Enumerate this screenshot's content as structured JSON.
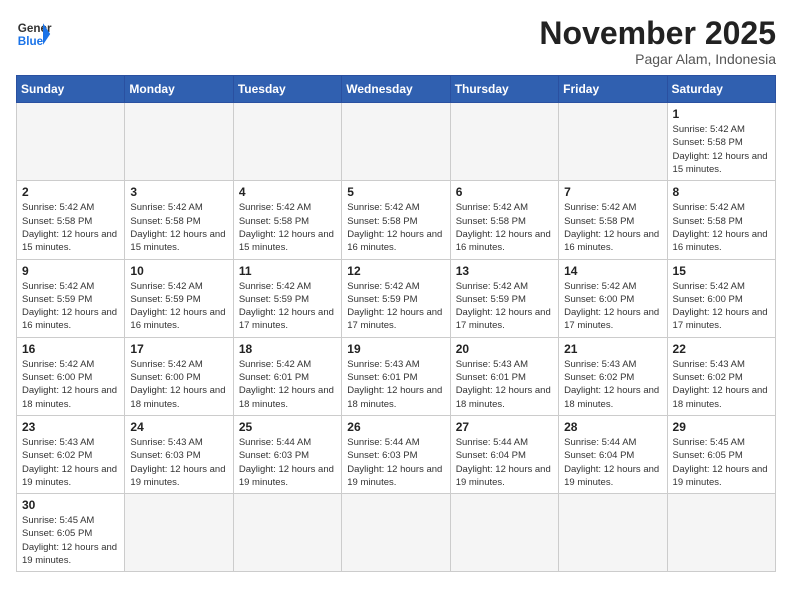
{
  "logo": {
    "general": "General",
    "blue": "Blue"
  },
  "header": {
    "month": "November 2025",
    "location": "Pagar Alam, Indonesia"
  },
  "weekdays": [
    "Sunday",
    "Monday",
    "Tuesday",
    "Wednesday",
    "Thursday",
    "Friday",
    "Saturday"
  ],
  "weeks": [
    [
      {
        "day": "",
        "info": ""
      },
      {
        "day": "",
        "info": ""
      },
      {
        "day": "",
        "info": ""
      },
      {
        "day": "",
        "info": ""
      },
      {
        "day": "",
        "info": ""
      },
      {
        "day": "",
        "info": ""
      },
      {
        "day": "1",
        "info": "Sunrise: 5:42 AM\nSunset: 5:58 PM\nDaylight: 12 hours and 15 minutes."
      }
    ],
    [
      {
        "day": "2",
        "info": "Sunrise: 5:42 AM\nSunset: 5:58 PM\nDaylight: 12 hours and 15 minutes."
      },
      {
        "day": "3",
        "info": "Sunrise: 5:42 AM\nSunset: 5:58 PM\nDaylight: 12 hours and 15 minutes."
      },
      {
        "day": "4",
        "info": "Sunrise: 5:42 AM\nSunset: 5:58 PM\nDaylight: 12 hours and 15 minutes."
      },
      {
        "day": "5",
        "info": "Sunrise: 5:42 AM\nSunset: 5:58 PM\nDaylight: 12 hours and 16 minutes."
      },
      {
        "day": "6",
        "info": "Sunrise: 5:42 AM\nSunset: 5:58 PM\nDaylight: 12 hours and 16 minutes."
      },
      {
        "day": "7",
        "info": "Sunrise: 5:42 AM\nSunset: 5:58 PM\nDaylight: 12 hours and 16 minutes."
      },
      {
        "day": "8",
        "info": "Sunrise: 5:42 AM\nSunset: 5:58 PM\nDaylight: 12 hours and 16 minutes."
      }
    ],
    [
      {
        "day": "9",
        "info": "Sunrise: 5:42 AM\nSunset: 5:59 PM\nDaylight: 12 hours and 16 minutes."
      },
      {
        "day": "10",
        "info": "Sunrise: 5:42 AM\nSunset: 5:59 PM\nDaylight: 12 hours and 16 minutes."
      },
      {
        "day": "11",
        "info": "Sunrise: 5:42 AM\nSunset: 5:59 PM\nDaylight: 12 hours and 17 minutes."
      },
      {
        "day": "12",
        "info": "Sunrise: 5:42 AM\nSunset: 5:59 PM\nDaylight: 12 hours and 17 minutes."
      },
      {
        "day": "13",
        "info": "Sunrise: 5:42 AM\nSunset: 5:59 PM\nDaylight: 12 hours and 17 minutes."
      },
      {
        "day": "14",
        "info": "Sunrise: 5:42 AM\nSunset: 6:00 PM\nDaylight: 12 hours and 17 minutes."
      },
      {
        "day": "15",
        "info": "Sunrise: 5:42 AM\nSunset: 6:00 PM\nDaylight: 12 hours and 17 minutes."
      }
    ],
    [
      {
        "day": "16",
        "info": "Sunrise: 5:42 AM\nSunset: 6:00 PM\nDaylight: 12 hours and 18 minutes."
      },
      {
        "day": "17",
        "info": "Sunrise: 5:42 AM\nSunset: 6:00 PM\nDaylight: 12 hours and 18 minutes."
      },
      {
        "day": "18",
        "info": "Sunrise: 5:42 AM\nSunset: 6:01 PM\nDaylight: 12 hours and 18 minutes."
      },
      {
        "day": "19",
        "info": "Sunrise: 5:43 AM\nSunset: 6:01 PM\nDaylight: 12 hours and 18 minutes."
      },
      {
        "day": "20",
        "info": "Sunrise: 5:43 AM\nSunset: 6:01 PM\nDaylight: 12 hours and 18 minutes."
      },
      {
        "day": "21",
        "info": "Sunrise: 5:43 AM\nSunset: 6:02 PM\nDaylight: 12 hours and 18 minutes."
      },
      {
        "day": "22",
        "info": "Sunrise: 5:43 AM\nSunset: 6:02 PM\nDaylight: 12 hours and 18 minutes."
      }
    ],
    [
      {
        "day": "23",
        "info": "Sunrise: 5:43 AM\nSunset: 6:02 PM\nDaylight: 12 hours and 19 minutes."
      },
      {
        "day": "24",
        "info": "Sunrise: 5:43 AM\nSunset: 6:03 PM\nDaylight: 12 hours and 19 minutes."
      },
      {
        "day": "25",
        "info": "Sunrise: 5:44 AM\nSunset: 6:03 PM\nDaylight: 12 hours and 19 minutes."
      },
      {
        "day": "26",
        "info": "Sunrise: 5:44 AM\nSunset: 6:03 PM\nDaylight: 12 hours and 19 minutes."
      },
      {
        "day": "27",
        "info": "Sunrise: 5:44 AM\nSunset: 6:04 PM\nDaylight: 12 hours and 19 minutes."
      },
      {
        "day": "28",
        "info": "Sunrise: 5:44 AM\nSunset: 6:04 PM\nDaylight: 12 hours and 19 minutes."
      },
      {
        "day": "29",
        "info": "Sunrise: 5:45 AM\nSunset: 6:05 PM\nDaylight: 12 hours and 19 minutes."
      }
    ],
    [
      {
        "day": "30",
        "info": "Sunrise: 5:45 AM\nSunset: 6:05 PM\nDaylight: 12 hours and 19 minutes."
      },
      {
        "day": "",
        "info": ""
      },
      {
        "day": "",
        "info": ""
      },
      {
        "day": "",
        "info": ""
      },
      {
        "day": "",
        "info": ""
      },
      {
        "day": "",
        "info": ""
      },
      {
        "day": "",
        "info": ""
      }
    ]
  ]
}
